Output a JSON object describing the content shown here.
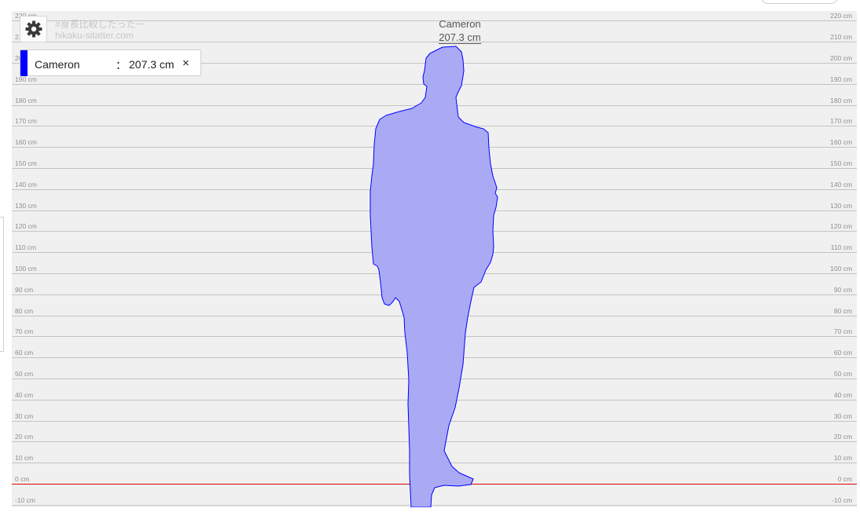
{
  "watermark": {
    "line1": "#身長比較したったー",
    "line2": "hikaku-sitatter.com"
  },
  "settings": {
    "icon": "gear-icon"
  },
  "scale": {
    "unit": "cm",
    "ticks": [
      "220 cm",
      "210 cm",
      "200 cm",
      "190 cm",
      "180 cm",
      "170 cm",
      "160 cm",
      "150 cm",
      "140 cm",
      "130 cm",
      "120 cm",
      "110 cm",
      "100 cm",
      "90 cm",
      "80 cm",
      "70 cm",
      "60 cm",
      "50 cm",
      "40 cm",
      "30 cm",
      "20 cm",
      "10 cm",
      "0 cm",
      "-10 cm"
    ],
    "tick_values": [
      220,
      210,
      200,
      190,
      180,
      170,
      160,
      150,
      140,
      130,
      120,
      110,
      100,
      90,
      80,
      70,
      60,
      50,
      40,
      30,
      20,
      10,
      0,
      -10
    ],
    "baseline_color": "#e00000"
  },
  "people": [
    {
      "name": "Cameron",
      "separator": "：",
      "height_label": "207.3 cm",
      "height_cm": 207.3,
      "color": "#0000ff",
      "fill": "#aaaaf4",
      "close_label": "×"
    }
  ]
}
